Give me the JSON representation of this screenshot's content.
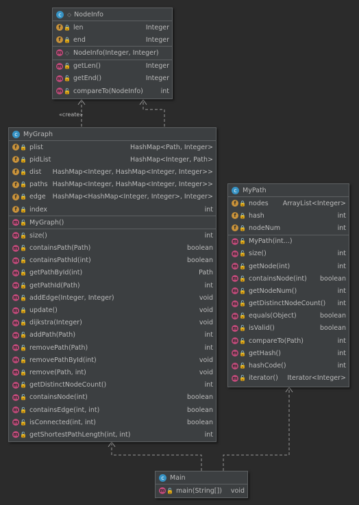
{
  "nodeinfo": {
    "title": "NodeInfo",
    "fields": [
      {
        "name": "len",
        "type": "Integer"
      },
      {
        "name": "end",
        "type": "Integer"
      }
    ],
    "constructors": [
      {
        "name": "NodeInfo(Integer, Integer)",
        "type": ""
      }
    ],
    "methods": [
      {
        "name": "getLen()",
        "type": "Integer"
      },
      {
        "name": "getEnd()",
        "type": "Integer"
      },
      {
        "name": "compareTo(NodeInfo)",
        "type": "int"
      }
    ]
  },
  "mygraph": {
    "title": "MyGraph",
    "fields": [
      {
        "name": "plist",
        "type": "HashMap<Path, Integer>"
      },
      {
        "name": "pidList",
        "type": "HashMap<Integer, Path>"
      },
      {
        "name": "dist",
        "type": "HashMap<Integer, HashMap<Integer, Integer>>"
      },
      {
        "name": "paths",
        "type": "HashMap<Integer, HashMap<Integer, Integer>>"
      },
      {
        "name": "edge",
        "type": "HashMap<HashMap<Integer, Integer>, Integer>"
      },
      {
        "name": "index",
        "type": "int"
      }
    ],
    "constructors": [
      {
        "name": "MyGraph()",
        "type": ""
      }
    ],
    "methods": [
      {
        "name": "size()",
        "type": "int"
      },
      {
        "name": "containsPath(Path)",
        "type": "boolean"
      },
      {
        "name": "containsPathId(int)",
        "type": "boolean"
      },
      {
        "name": "getPathById(int)",
        "type": "Path"
      },
      {
        "name": "getPathId(Path)",
        "type": "int"
      },
      {
        "name": "addEdge(Integer, Integer)",
        "type": "void"
      },
      {
        "name": "update()",
        "type": "void"
      },
      {
        "name": "dijkstra(Integer)",
        "type": "void"
      },
      {
        "name": "addPath(Path)",
        "type": "int"
      },
      {
        "name": "removePath(Path)",
        "type": "int"
      },
      {
        "name": "removePathById(int)",
        "type": "void"
      },
      {
        "name": "remove(Path, int)",
        "type": "void"
      },
      {
        "name": "getDistinctNodeCount()",
        "type": "int"
      },
      {
        "name": "containsNode(int)",
        "type": "boolean"
      },
      {
        "name": "containsEdge(int, int)",
        "type": "boolean"
      },
      {
        "name": "isConnected(int, int)",
        "type": "boolean"
      },
      {
        "name": "getShortestPathLength(int, int)",
        "type": "int"
      }
    ]
  },
  "mypath": {
    "title": "MyPath",
    "fields": [
      {
        "name": "nodes",
        "type": "ArrayList<Integer>"
      },
      {
        "name": "hash",
        "type": "int"
      },
      {
        "name": "nodeNum",
        "type": "int"
      }
    ],
    "methods": [
      {
        "name": "MyPath(int...)",
        "type": ""
      },
      {
        "name": "size()",
        "type": "int"
      },
      {
        "name": "getNode(int)",
        "type": "int"
      },
      {
        "name": "containsNode(int)",
        "type": "boolean"
      },
      {
        "name": "getNodeNum()",
        "type": "int"
      },
      {
        "name": "getDistinctNodeCount()",
        "type": "int"
      },
      {
        "name": "equals(Object)",
        "type": "boolean"
      },
      {
        "name": "isValid()",
        "type": "boolean"
      },
      {
        "name": "compareTo(Path)",
        "type": "int"
      },
      {
        "name": "getHash()",
        "type": "int"
      },
      {
        "name": "hashCode()",
        "type": "int"
      },
      {
        "name": "iterator()",
        "type": "Iterator<Integer>"
      }
    ]
  },
  "main": {
    "title": "Main",
    "methods": [
      {
        "name": "main(String[])",
        "type": "void"
      }
    ]
  },
  "edge_labels": {
    "creates": "«create»"
  }
}
